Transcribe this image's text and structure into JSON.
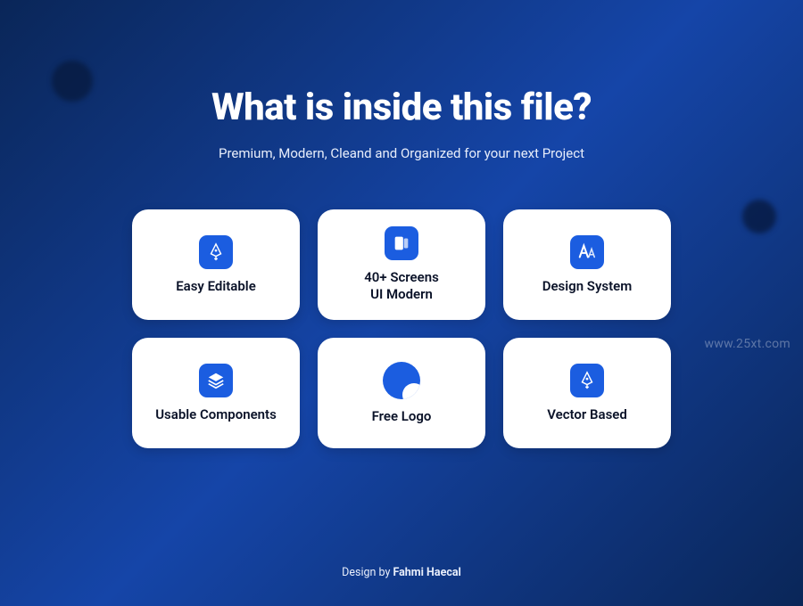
{
  "title": "What is inside this file?",
  "subtitle": "Premium, Modern, Cleand and Organized for your next Project",
  "cards": [
    {
      "label": "Easy Editable",
      "icon": "pen-tool"
    },
    {
      "label": "40+ Screens\nUI Modern",
      "icon": "screens"
    },
    {
      "label": "Design System",
      "icon": "typography"
    },
    {
      "label": "Usable Components",
      "icon": "layers"
    },
    {
      "label": "Free Logo",
      "icon": "logo-circle"
    },
    {
      "label": "Vector Based",
      "icon": "pen-tool"
    }
  ],
  "watermark": "www.25xt.com",
  "footer": {
    "prefix": "Design by ",
    "author": "Fahmi Haecal"
  }
}
